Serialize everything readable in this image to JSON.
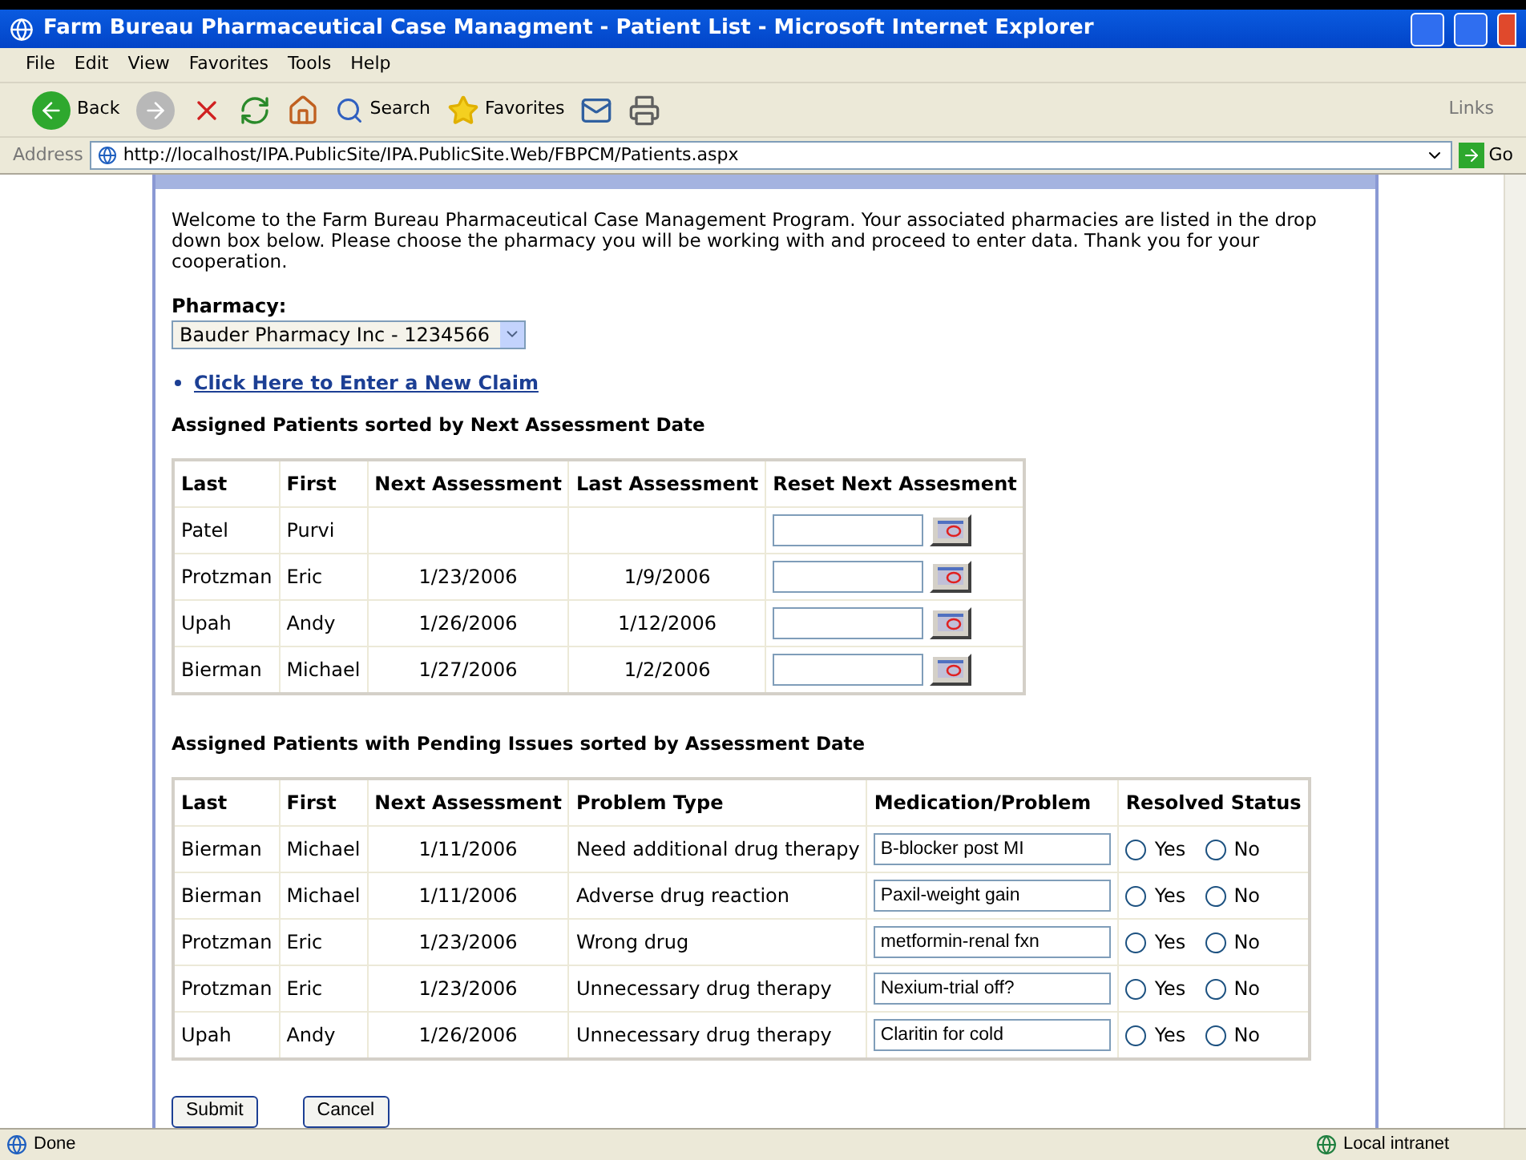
{
  "window": {
    "title": "Farm Bureau Pharmaceutical Case Managment - Patient List - Microsoft Internet Explorer"
  },
  "menu": [
    "File",
    "Edit",
    "View",
    "Favorites",
    "Tools",
    "Help"
  ],
  "toolbar": {
    "back": "Back",
    "search": "Search",
    "favorites": "Favorites",
    "links": "Links"
  },
  "address": {
    "label": "Address",
    "url": "http://localhost/IPA.PublicSite/IPA.PublicSite.Web/FBPCM/Patients.aspx",
    "go": "Go"
  },
  "intro": "Welcome to the Farm Bureau Pharmaceutical Case Management Program. Your associated pharmacies are listed in the drop down box below. Please choose the pharmacy you will be working with and proceed to enter data. Thank you for your cooperation.",
  "pharmacy": {
    "label": "Pharmacy:",
    "value": "Bauder Pharmacy Inc - 1234566"
  },
  "new_claim_link": "Click Here to Enter a New Claim",
  "assigned": {
    "heading": "Assigned Patients sorted by Next Assessment Date",
    "columns": [
      "Last",
      "First",
      "Next Assessment",
      "Last Assessment",
      "Reset Next Assesment"
    ],
    "rows": [
      {
        "last": "Patel",
        "first": "Purvi",
        "next": "",
        "last_assessment": ""
      },
      {
        "last": "Protzman",
        "first": "Eric",
        "next": "1/23/2006",
        "last_assessment": "1/9/2006"
      },
      {
        "last": "Upah",
        "first": "Andy",
        "next": "1/26/2006",
        "last_assessment": "1/12/2006"
      },
      {
        "last": "Bierman",
        "first": "Michael",
        "next": "1/27/2006",
        "last_assessment": "1/2/2006"
      }
    ]
  },
  "pending": {
    "heading": "Assigned Patients with Pending Issues sorted by Assessment Date",
    "columns": [
      "Last",
      "First",
      "Next Assessment",
      "Problem Type",
      "Medication/Problem",
      "Resolved Status"
    ],
    "rows": [
      {
        "last": "Bierman",
        "first": "Michael",
        "next": "1/11/2006",
        "problem": "Need additional drug therapy",
        "medication": "B-blocker post MI",
        "options": [
          {
            "label": "Yes",
            "selected": false
          },
          {
            "label": "No",
            "selected": false
          }
        ]
      },
      {
        "last": "Bierman",
        "first": "Michael",
        "next": "1/11/2006",
        "problem": "Adverse drug reaction",
        "medication": "Paxil-weight gain",
        "options": [
          {
            "label": "Yes",
            "selected": false
          },
          {
            "label": "No",
            "selected": false
          }
        ]
      },
      {
        "last": "Protzman",
        "first": "Eric",
        "next": "1/23/2006",
        "problem": "Wrong drug",
        "medication": "metformin-renal fxn",
        "options": [
          {
            "label": "Yes",
            "selected": false
          },
          {
            "label": "No",
            "selected": false
          }
        ]
      },
      {
        "last": "Protzman",
        "first": "Eric",
        "next": "1/23/2006",
        "problem": "Unnecessary drug therapy",
        "medication": "Nexium-trial off?",
        "options": [
          {
            "label": "Yes",
            "selected": false
          },
          {
            "label": "No",
            "selected": false
          }
        ]
      },
      {
        "last": "Upah",
        "first": "Andy",
        "next": "1/26/2006",
        "problem": "Unnecessary drug therapy",
        "medication": "Claritin for cold",
        "options": [
          {
            "label": "Yes",
            "selected": false
          },
          {
            "label": "No",
            "selected": false
          }
        ]
      }
    ]
  },
  "buttons": [
    "Submit",
    "Cancel"
  ],
  "status_bar": {
    "text": "Done",
    "zone": "Local intranet"
  }
}
